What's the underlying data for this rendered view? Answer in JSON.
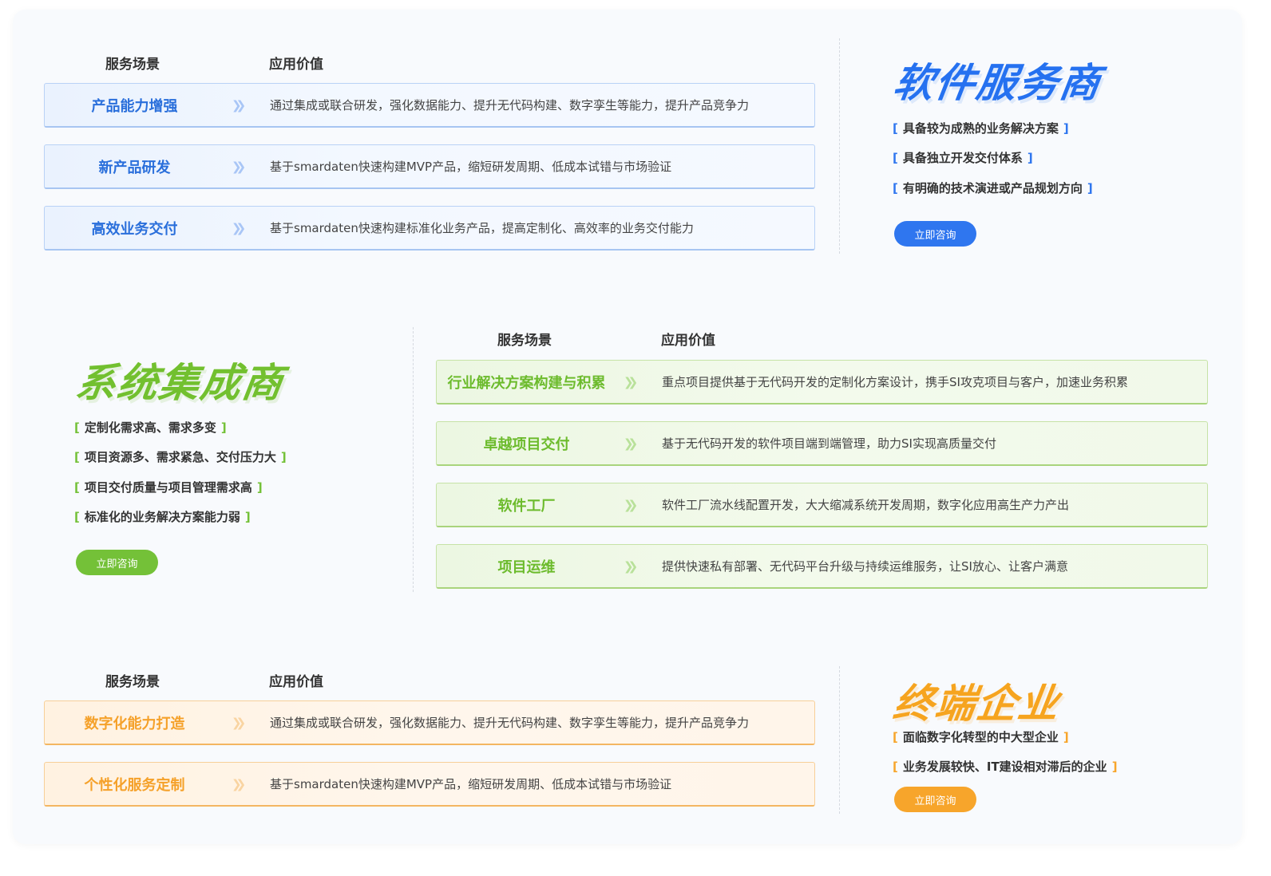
{
  "colors": {
    "blue": "#2f76ef",
    "green": "#74c138",
    "orange": "#f7a52b"
  },
  "icons": {
    "row_arrow": "double-chevron-right-icon"
  },
  "software_vendor": {
    "title": "软件服务商",
    "col_scene": "服务场景",
    "col_value": "应用价值",
    "rows": [
      {
        "scene": "产品能力增强",
        "value": "通过集成或联合研发，强化数据能力、提升无代码构建、数字孪生等能力，提升产品竞争力"
      },
      {
        "scene": "新产品研发",
        "value": "基于smardaten快速构建MVP产品，缩短研发周期、低成本试错与市场验证"
      },
      {
        "scene": "高效业务交付",
        "value": "基于smardaten快速构建标准化业务产品，提高定制化、高效率的业务交付能力"
      }
    ],
    "features": [
      "具备较为成熟的业务解决方案",
      "具备独立开发交付体系",
      "有明确的技术演进或产品规划方向"
    ],
    "button": "立即咨询"
  },
  "system_integrator": {
    "title": "系统集成商",
    "col_scene": "服务场景",
    "col_value": "应用价值",
    "rows": [
      {
        "scene": "行业解决方案构建与积累",
        "value": "重点项目提供基于无代码开发的定制化方案设计，携手SI攻克项目与客户，加速业务积累"
      },
      {
        "scene": "卓越项目交付",
        "value": "基于无代码开发的软件项目端到端管理，助力SI实现高质量交付"
      },
      {
        "scene": "软件工厂",
        "value": "软件工厂流水线配置开发，大大缩减系统开发周期，数字化应用高生产力产出"
      },
      {
        "scene": "项目运维",
        "value": "提供快速私有部署、无代码平台升级与持续运维服务，让SI放心、让客户满意"
      }
    ],
    "features": [
      "定制化需求高、需求多变",
      "项目资源多、需求紧急、交付压力大",
      "项目交付质量与项目管理需求高",
      "标准化的业务解决方案能力弱"
    ],
    "button": "立即咨询"
  },
  "end_enterprise": {
    "title": "终端企业",
    "col_scene": "服务场景",
    "col_value": "应用价值",
    "rows": [
      {
        "scene": "数字化能力打造",
        "value": "通过集成或联合研发，强化数据能力、提升无代码构建、数字孪生等能力，提升产品竞争力"
      },
      {
        "scene": "个性化服务定制",
        "value": "基于smardaten快速构建MVP产品，缩短研发周期、低成本试错与市场验证"
      }
    ],
    "features": [
      "面临数字化转型的中大型企业",
      "业务发展较快、IT建设相对滞后的企业"
    ],
    "button": "立即咨询"
  }
}
